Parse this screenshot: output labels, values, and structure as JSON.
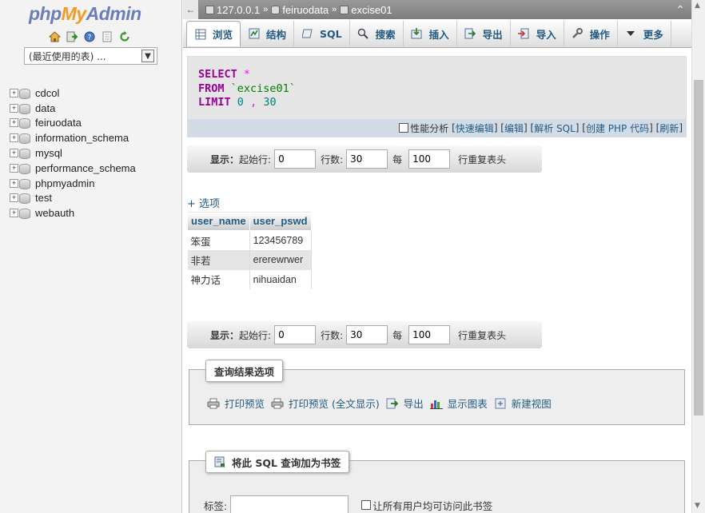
{
  "sidebar": {
    "logo": {
      "php": "php",
      "my": "My",
      "admin": "Admin"
    },
    "recent_select": "(最近使用的表) ...",
    "databases": [
      "cdcol",
      "data",
      "feiruodata",
      "information_schema",
      "mysql",
      "performance_schema",
      "phpmyadmin",
      "test",
      "webauth"
    ]
  },
  "breadcrumb": {
    "server": "127.0.0.1",
    "database": "feiruodata",
    "table": "excise01"
  },
  "tabs": [
    {
      "label": "浏览",
      "icon": "browse-icon"
    },
    {
      "label": "结构",
      "icon": "structure-icon"
    },
    {
      "label": "SQL",
      "icon": "sql-icon"
    },
    {
      "label": "搜索",
      "icon": "search-icon"
    },
    {
      "label": "插入",
      "icon": "insert-icon"
    },
    {
      "label": "导出",
      "icon": "export-icon"
    },
    {
      "label": "导入",
      "icon": "import-icon"
    },
    {
      "label": "操作",
      "icon": "wrench-icon"
    },
    {
      "label": "更多",
      "icon": "chevron-down-icon"
    }
  ],
  "sql": {
    "select_kw": "SELECT",
    "star": "*",
    "from_kw": "FROM",
    "table": "`excise01`",
    "limit_kw": "LIMIT",
    "limit_start": "0",
    "comma": ",",
    "limit_count": "30"
  },
  "sql_links": {
    "profiling": "性能分析",
    "quick_edit": "快速编辑",
    "edit": "编辑",
    "explain": "解析 SQL",
    "create_php": "创建 PHP 代码",
    "refresh": "刷新"
  },
  "nav": {
    "show": "显示：",
    "start_label": "起始行:",
    "start_value": "0",
    "rows_label": "行数:",
    "rows_value": "30",
    "every_label": "每",
    "every_value": "100",
    "repeat_label": "行重复表头"
  },
  "options_link": "+ 选项",
  "table": {
    "headers": [
      "user_name",
      "user_pswd"
    ],
    "rows": [
      [
        "笨蛋",
        "123456789"
      ],
      [
        "非若",
        "ererewrwer"
      ],
      [
        "神力话",
        "nihuaidan"
      ]
    ]
  },
  "query_results": {
    "legend": "查询结果选项",
    "print_preview": "打印预览",
    "print_preview_full": "打印预览 (全文显示)",
    "export": "导出",
    "display_chart": "显示图表",
    "create_view": "新建视图"
  },
  "bookmark": {
    "legend": "将此 SQL 查询加为书签",
    "label": "标签:",
    "share_label": "让所有用户均可访问此书签"
  },
  "colors": {
    "link": "#235a81",
    "keyword": "#990099",
    "logo_blue": "#6c7eb7",
    "logo_orange": "#f29b24"
  }
}
